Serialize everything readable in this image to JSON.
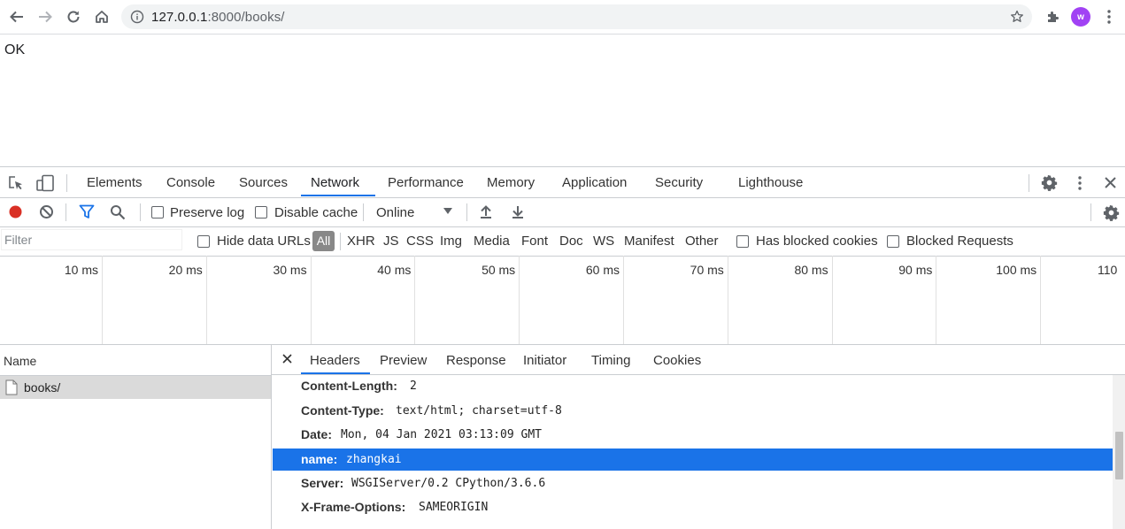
{
  "browser": {
    "url_host": "127.0.0.1",
    "url_path": ":8000/books/",
    "avatar_letter": "w",
    "avatar_color": "#a142f4"
  },
  "page": {
    "body_text": "OK"
  },
  "devtools": {
    "tabs": [
      "Elements",
      "Console",
      "Sources",
      "Network",
      "Performance",
      "Memory",
      "Application",
      "Security",
      "Lighthouse"
    ],
    "active_tab": "Network",
    "toolbar": {
      "preserve_log": "Preserve log",
      "disable_cache": "Disable cache",
      "throttle": "Online"
    },
    "filter": {
      "placeholder": "Filter",
      "hide_data_urls": "Hide data URLs",
      "all": "All",
      "types": [
        "XHR",
        "JS",
        "CSS",
        "Img",
        "Media",
        "Font",
        "Doc",
        "WS",
        "Manifest",
        "Other"
      ],
      "has_blocked_cookies": "Has blocked cookies",
      "blocked_requests": "Blocked Requests"
    },
    "overview": {
      "ticks": [
        "10 ms",
        "20 ms",
        "30 ms",
        "40 ms",
        "50 ms",
        "60 ms",
        "70 ms",
        "80 ms",
        "90 ms",
        "100 ms",
        "110"
      ]
    },
    "requests": {
      "name_header": "Name",
      "items": [
        "books/"
      ]
    },
    "detail": {
      "tabs": [
        "Headers",
        "Preview",
        "Response",
        "Initiator",
        "Timing",
        "Cookies"
      ],
      "active_tab": "Headers",
      "headers": [
        {
          "key": "Content-Length:",
          "value": "2"
        },
        {
          "key": "Content-Type:",
          "value": "text/html; charset=utf-8"
        },
        {
          "key": "Date:",
          "value": "Mon, 04 Jan 2021 03:13:09 GMT"
        },
        {
          "key": "name:",
          "value": "zhangkai",
          "selected": true
        },
        {
          "key": "Server:",
          "value": "WSGIServer/0.2 CPython/3.6.6"
        },
        {
          "key": "X-Frame-Options:",
          "value": "SAMEORIGIN"
        }
      ]
    },
    "colors": {
      "accent": "#1a73e8",
      "record": "#d93025"
    }
  }
}
